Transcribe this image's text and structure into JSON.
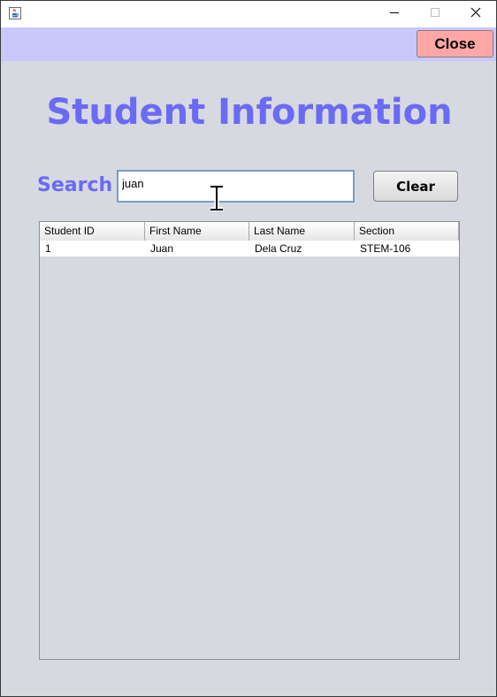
{
  "window": {
    "title_icon": "java-cup-icon",
    "controls": [
      "minimize-icon",
      "maximize-icon",
      "close-icon"
    ]
  },
  "header": {
    "close_label": "Close",
    "bar_color": "#c8c8fb",
    "close_color": "#ffa7a7"
  },
  "page": {
    "title": "Student Information",
    "accent": "#6a6af5"
  },
  "search": {
    "label": "Search",
    "value": "juan",
    "clear_label": "Clear"
  },
  "table": {
    "columns": [
      "Student ID",
      "First Name",
      "Last Name",
      "Section"
    ],
    "rows": [
      [
        "1",
        "Juan",
        "Dela Cruz",
        "STEM-106"
      ]
    ]
  }
}
